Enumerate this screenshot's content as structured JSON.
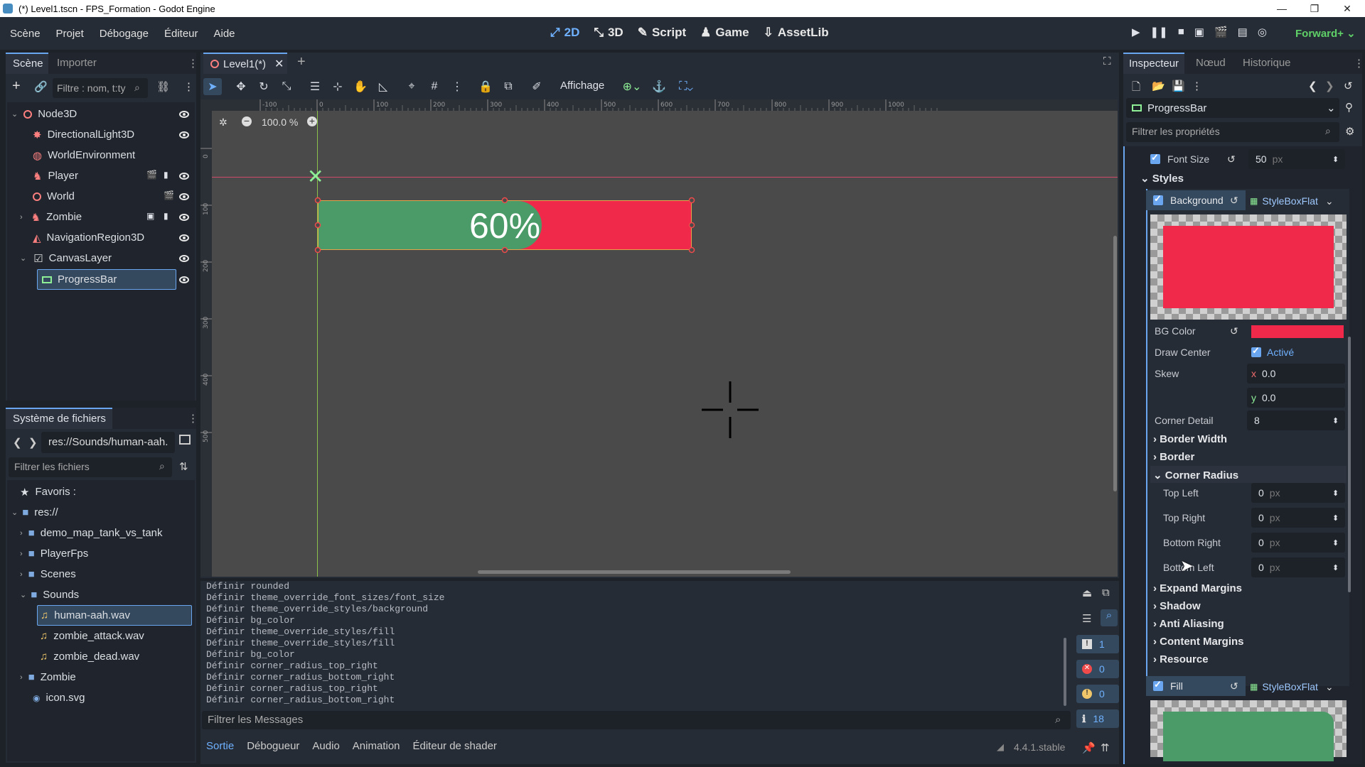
{
  "window": {
    "title": "(*) Level1.tscn - FPS_Formation - Godot Engine"
  },
  "menu": [
    "Scène",
    "Projet",
    "Débogage",
    "Éditeur",
    "Aide"
  ],
  "modes": [
    "2D",
    "3D",
    "Script",
    "Game",
    "AssetLib"
  ],
  "renderer": "Forward+",
  "scene_dock": {
    "tabs": [
      "Scène",
      "Importer"
    ],
    "filter_placeholder": "Filtre : nom, t:ty",
    "nodes": [
      {
        "label": "Node3D",
        "icon": "node3d-icon",
        "color": "#fc7f7f"
      },
      {
        "label": "DirectionalLight3D",
        "icon": "light-icon",
        "color": "#fc7f7f"
      },
      {
        "label": "WorldEnvironment",
        "icon": "environment-icon",
        "color": "#fc7f7f"
      },
      {
        "label": "Player",
        "icon": "character-icon",
        "color": "#fc7f7f"
      },
      {
        "label": "World",
        "icon": "node3d-icon",
        "color": "#fc7f7f"
      },
      {
        "label": "Zombie",
        "icon": "character-icon",
        "color": "#fc7f7f"
      },
      {
        "label": "NavigationRegion3D",
        "icon": "navigation-icon",
        "color": "#fc7f7f"
      },
      {
        "label": "CanvasLayer",
        "icon": "canvas-layer-icon",
        "color": "#e0e0e0"
      },
      {
        "label": "ProgressBar",
        "icon": "progressbar-icon",
        "color": "#8eef97"
      }
    ]
  },
  "filesystem_dock": {
    "title": "Système de fichiers",
    "path": "res://Sounds/human-aah.",
    "filter_placeholder": "Filtrer les fichiers",
    "items": [
      {
        "label": "Favoris :",
        "icon": "star-icon"
      },
      {
        "label": "res://",
        "icon": "folder-icon"
      },
      {
        "label": "demo_map_tank_vs_tank",
        "icon": "folder-icon"
      },
      {
        "label": "PlayerFps",
        "icon": "folder-icon"
      },
      {
        "label": "Scenes",
        "icon": "folder-icon"
      },
      {
        "label": "Sounds",
        "icon": "folder-icon"
      },
      {
        "label": "human-aah.wav",
        "icon": "audio-file-icon"
      },
      {
        "label": "zombie_attack.wav",
        "icon": "audio-file-icon"
      },
      {
        "label": "zombie_dead.wav",
        "icon": "audio-file-icon"
      },
      {
        "label": "Zombie",
        "icon": "folder-icon"
      },
      {
        "label": "icon.svg",
        "icon": "image-file-icon"
      }
    ]
  },
  "editor": {
    "tab_label": "Level1(*)",
    "view_menu": "Affichage",
    "zoom": "100.0 %",
    "progress_value": 0.6,
    "progress_text": "60%",
    "fill_color": "#4a9b68",
    "bg_color": "#f0284a",
    "ruler_ticks": [
      "-100",
      "0",
      "100",
      "200",
      "300",
      "400",
      "500",
      "600",
      "700",
      "800",
      "900",
      "1000"
    ],
    "vruler_ticks": [
      "0",
      "100",
      "200",
      "300",
      "400",
      "500"
    ]
  },
  "output": {
    "lines": [
      "Définir rounded",
      "Définir theme_override_font_sizes/font_size",
      "Définir theme_override_styles/background",
      "Définir bg_color",
      "Définir theme_override_styles/fill",
      "Définir theme_override_styles/fill",
      "Définir bg_color",
      "Définir corner_radius_top_right",
      "Définir corner_radius_bottom_right",
      "Définir corner_radius_top_right",
      "Définir corner_radius_bottom_right"
    ],
    "filter_placeholder": "Filtrer les Messages",
    "counts": {
      "messages": "1",
      "errors": "0",
      "warnings": "0",
      "info": "18"
    },
    "bottom_tabs": [
      "Sortie",
      "Débogueur",
      "Audio",
      "Animation",
      "Éditeur de shader"
    ],
    "version": "4.4.1.stable"
  },
  "inspector": {
    "tabs": [
      "Inspecteur",
      "Nœud",
      "Historique"
    ],
    "node_name": "ProgressBar",
    "filter_placeholder": "Filtrer les propriétés",
    "font_size": {
      "label": "Font Size",
      "value": "50",
      "unit": "px"
    },
    "styles_label": "Styles",
    "background": {
      "label": "Background",
      "type": "StyleBoxFlat"
    },
    "bg_color_label": "BG Color",
    "draw_center": {
      "label": "Draw Center",
      "value": "Activé"
    },
    "skew": {
      "label": "Skew",
      "x_label": "x",
      "x": "0.0",
      "y_label": "y",
      "y": "0.0"
    },
    "corner_detail": {
      "label": "Corner Detail",
      "value": "8"
    },
    "sections": [
      "Border Width",
      "Border",
      "Corner Radius",
      "Expand Margins",
      "Shadow",
      "Anti Aliasing",
      "Content Margins",
      "Resource"
    ],
    "corner_radius": [
      {
        "label": "Top Left",
        "value": "0",
        "unit": "px"
      },
      {
        "label": "Top Right",
        "value": "0",
        "unit": "px"
      },
      {
        "label": "Bottom Right",
        "value": "0",
        "unit": "px"
      },
      {
        "label": "Bottom Left",
        "value": "0",
        "unit": "px"
      }
    ],
    "fill": {
      "label": "Fill",
      "type": "StyleBoxFlat"
    }
  }
}
